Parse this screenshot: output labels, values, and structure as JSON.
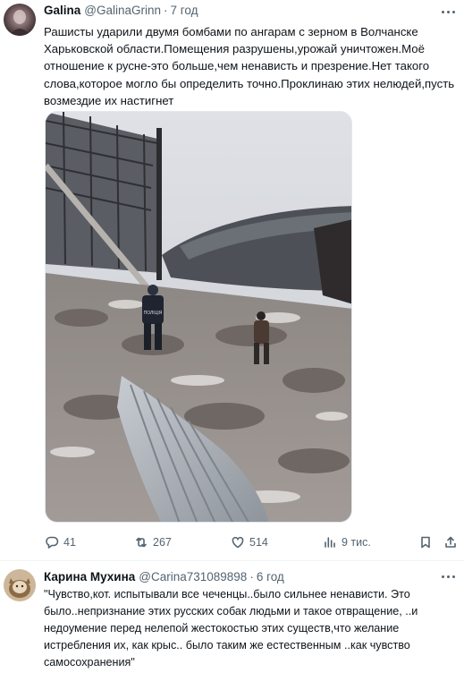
{
  "tweets": [
    {
      "author_name": "Galina",
      "handle": "@GalinaGrinn",
      "separator": "·",
      "time": "7 год",
      "text": "Рашисты ударили двумя бомбами по ангарам с зерном в Волчанске Харьковской области.Помещения разрушены,урожай уничтожен.Моё отношение к русне-это больше,чем ненависть и презрение.Нет такого слова,которое могло бы определить точно.Проклинаю этих нелюдей,пусть возмездие их настигнет",
      "media": {
        "vest_label": "ПОЛІЦІЯ"
      },
      "actions": {
        "replies": "41",
        "reposts": "267",
        "likes": "514",
        "views": "9 тис."
      }
    },
    {
      "author_name": "Карина Мухина",
      "handle": "@Carina731089898",
      "separator": "·",
      "time": "6 год",
      "text": "\"Чувство,кот. испытывали все чеченцы..было сильнее ненависти. Это было..непризнание этих русских собак людьми и такое отвращение, ..и недоумение перед нелепой жестокостью этих существ,что желание истребления их, как крыс.. было таким же естественным ..как чувство самосохранения\""
    }
  ],
  "colors": {
    "text": "#0f1419",
    "secondary": "#536471",
    "divider": "#eff3f4"
  },
  "icons": [
    "more-icon",
    "reply-icon",
    "repost-icon",
    "like-icon",
    "views-icon",
    "bookmark-icon",
    "share-icon"
  ]
}
